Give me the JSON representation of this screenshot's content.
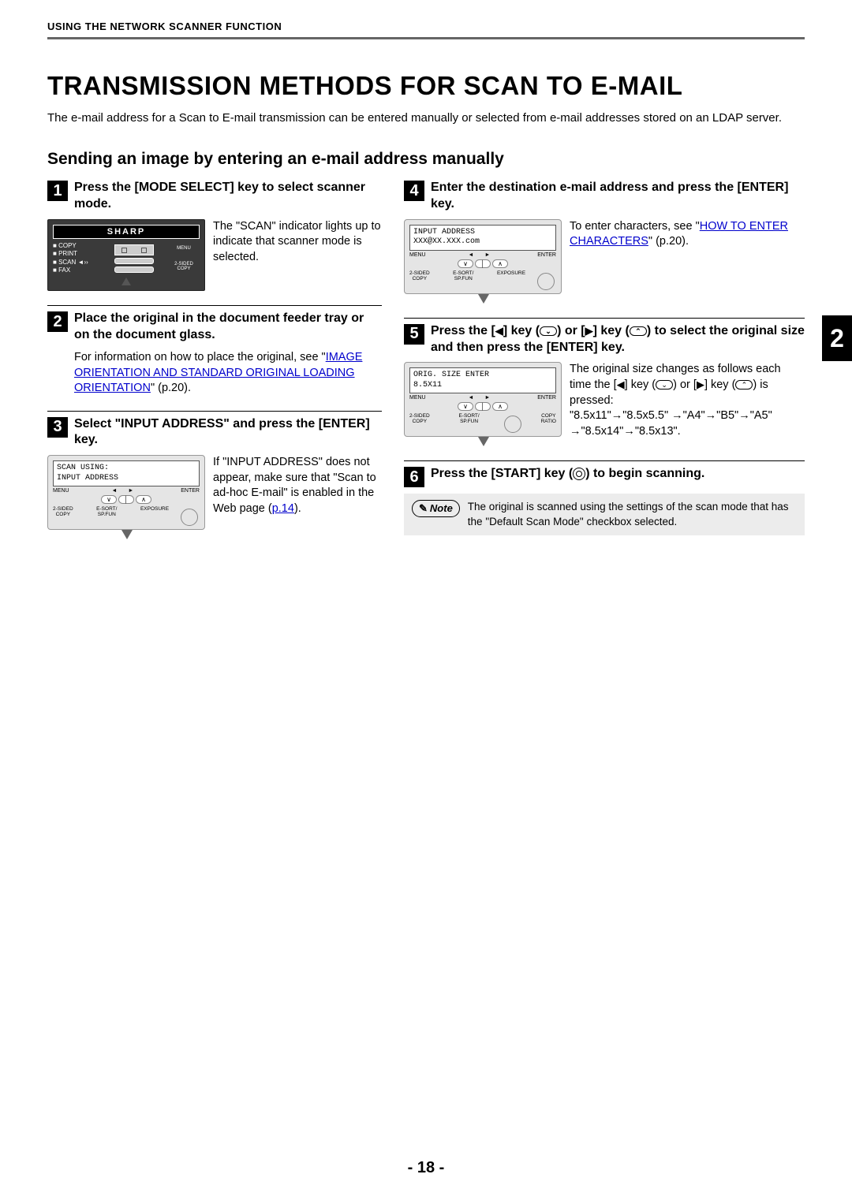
{
  "runningHeader": "USING THE NETWORK SCANNER FUNCTION",
  "title": "TRANSMISSION METHODS FOR SCAN TO E-MAIL",
  "intro": "The e-mail address for a Scan to E-mail transmission can be entered manually or selected from e-mail addresses stored on an LDAP server.",
  "subheading": "Sending an image by entering an e-mail address manually",
  "sideTab": "2",
  "pageNumber": "- 18 -",
  "panel1": {
    "brand": "SHARP",
    "modes": [
      "COPY",
      "PRINT",
      "SCAN",
      "FAX"
    ],
    "menu": "MENU",
    "twoSidedCopy": "2-SIDED COPY",
    "scanActive": "◄››"
  },
  "lcd3": {
    "line1": "SCAN USING:",
    "line2": "INPUT ADDRESS"
  },
  "lcd4": {
    "line1": "INPUT ADDRESS",
    "line2": "XXX@XX.XXX.com"
  },
  "lcd5": {
    "line1": "ORIG. SIZE ENTER",
    "line2": "8.5X11"
  },
  "devLabels": {
    "menu": "MENU",
    "enter": "ENTER",
    "twoSidedCopy": "2-SIDED\nCOPY",
    "esort": "E-SORT/\nSP.FUN",
    "exposure": "EXPOSURE",
    "copyRatio": "COPY\nRATIO"
  },
  "steps": {
    "s1": {
      "num": "1",
      "title": "Press the [MODE SELECT] key to select scanner mode.",
      "body": "The \"SCAN\" indicator lights up to indicate that scanner mode is selected."
    },
    "s2": {
      "num": "2",
      "title": "Place the original in the document feeder tray or on the document glass.",
      "bodyPrefix": "For information on how to place the original, see \"",
      "linkText": "IMAGE ORIENTATION AND STANDARD ORIGINAL LOADING ORIENTATION",
      "bodySuffix": "\" (p.20)."
    },
    "s3": {
      "num": "3",
      "title": "Select \"INPUT ADDRESS\" and press the [ENTER] key.",
      "body1": "If \"INPUT ADDRESS\" does not appear, make sure that \"Scan to ad-hoc E-mail\" is enabled in the Web page (",
      "link": "p.14",
      "body2": ")."
    },
    "s4": {
      "num": "4",
      "title": "Enter the destination e-mail address and press the [ENTER] key.",
      "bodyPrefix": "To enter characters, see \"",
      "linkText": "HOW TO ENTER CHARACTERS",
      "bodySuffix": "\" (p.20)."
    },
    "s5": {
      "num": "5",
      "titleParts": {
        "a": "Press the [",
        "b": "] key (",
        "c": ") or [",
        "d": "] key (",
        "e": ") to select the original size and then press the [ENTER] key."
      },
      "body": {
        "a": "The original size changes as follows each time the [",
        "b": "] key (",
        "c": ") or [",
        "d": "] key (",
        "e": ") is pressed:",
        "seq": "\"8.5x11\"→\"8.5x5.5\" →\"A4\"→\"B5\"→\"A5\" →\"8.5x14\"→\"8.5x13\"."
      }
    },
    "s6": {
      "num": "6",
      "titleParts": {
        "a": "Press the [START] key (",
        "b": ") to begin scanning."
      }
    }
  },
  "note": {
    "label": "Note",
    "text": "The original is scanned using the settings of the scan mode that has the \"Default Scan Mode\" checkbox selected."
  }
}
